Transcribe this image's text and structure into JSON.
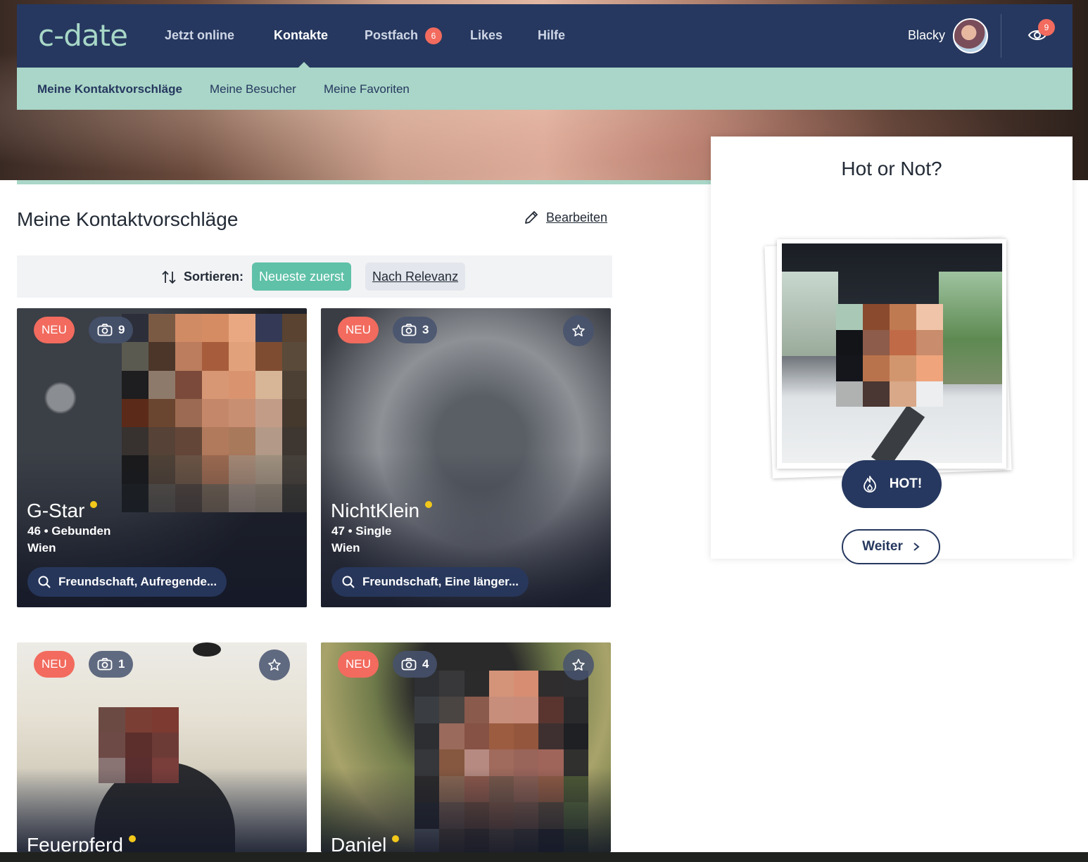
{
  "header": {
    "logo": "c-date",
    "nav": [
      {
        "label": "Jetzt online"
      },
      {
        "label": "Kontakte",
        "active": true
      },
      {
        "label": "Postfach",
        "badge": "6"
      },
      {
        "label": "Likes"
      },
      {
        "label": "Hilfe"
      }
    ],
    "user_name": "Blacky",
    "visitors_badge": "9"
  },
  "subnav": {
    "items": [
      {
        "label": "Meine Kontaktvorschläge",
        "active": true
      },
      {
        "label": "Meine Besucher"
      },
      {
        "label": "Meine Favoriten"
      }
    ]
  },
  "main": {
    "title": "Meine Kontaktvorschläge",
    "edit_label": "Bearbeiten",
    "sort": {
      "label": "Sortieren:",
      "options": [
        "Neueste zuerst",
        "Nach Relevanz"
      ],
      "selected": "Neueste zuerst"
    },
    "cards": [
      {
        "badge": "NEU",
        "photos": "9",
        "name": "G-Star",
        "meta": "46 • Gebunden",
        "city": "Wien",
        "interests": "Freundschaft, Aufregende..."
      },
      {
        "badge": "NEU",
        "photos": "3",
        "name": "NichtKlein",
        "meta": "47 • Single",
        "city": "Wien",
        "interests": "Freundschaft, Eine länger..."
      },
      {
        "badge": "NEU",
        "photos": "1",
        "name": "Feuerpferd"
      },
      {
        "badge": "NEU",
        "photos": "4",
        "name": "Daniel"
      }
    ]
  },
  "hot_or_not": {
    "title": "Hot or Not?",
    "hot_label": "HOT!",
    "next_label": "Weiter"
  },
  "colors": {
    "nav_bg": "#26385f",
    "accent_mint": "#a9d6c8",
    "accent_green": "#5fc1a8",
    "badge_red": "#f26b5e",
    "online_yellow": "#f2c81a"
  }
}
